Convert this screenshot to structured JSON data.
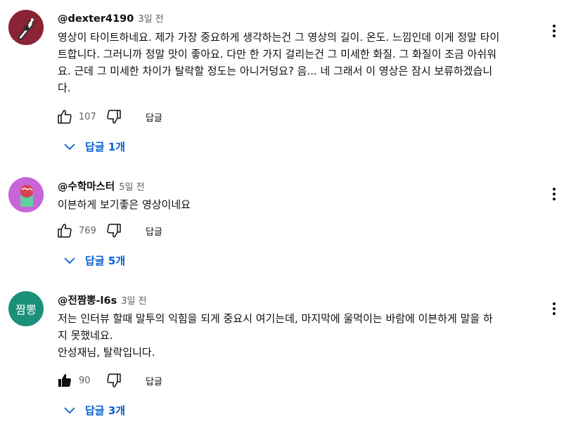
{
  "comments": [
    {
      "handle": "@dexter4190",
      "time": "3일 전",
      "lines": [
        "영상이 타이트하네요. 제가 가장 중요하게 생각하는건 그 영상의 길이. 온도. 느낌인데 이게 정말 타이",
        "트합니다. 그러니까 정말 맛이 좋아요. 다만 한 가지 걸리는건 그 미세한 화질. 그 화질이 조금 아쉬워",
        "요. 근데 그 미세한 차이가 탈락할 정도는 아니거덩요? 음... 네 그래서 이 영상은 잠시 보류하겠습니",
        "다."
      ],
      "likes": "107",
      "reply_label": "답글",
      "replies_label": "답글 1개"
    },
    {
      "handle": "@수학마스터",
      "time": "5일 전",
      "lines": [
        "이븐하게 보기좋은 영상이네요"
      ],
      "likes": "769",
      "reply_label": "답글",
      "replies_label": "답글 5개"
    },
    {
      "handle": "@전짬뽕-l6s",
      "time": "3일 전",
      "avatar_text": "짬뽕",
      "lines": [
        "저는 인터뷰 할때 말투의 익힘을 되게 중요시 여기는데, 마지막에 울먹이는 바람에 이븐하게 말을 하",
        "지 못했네요.",
        "안성재님, 탈락입니다."
      ],
      "likes": "90",
      "reply_label": "답글",
      "replies_label": "답글 3개"
    }
  ],
  "colors": {
    "link": "#065fd4",
    "meta": "#606060",
    "avatar3": "#1a8f7a"
  },
  "icons": [
    "like-icon",
    "liked-icon",
    "dislike-icon",
    "chevron-down-icon",
    "more-vert-icon"
  ]
}
